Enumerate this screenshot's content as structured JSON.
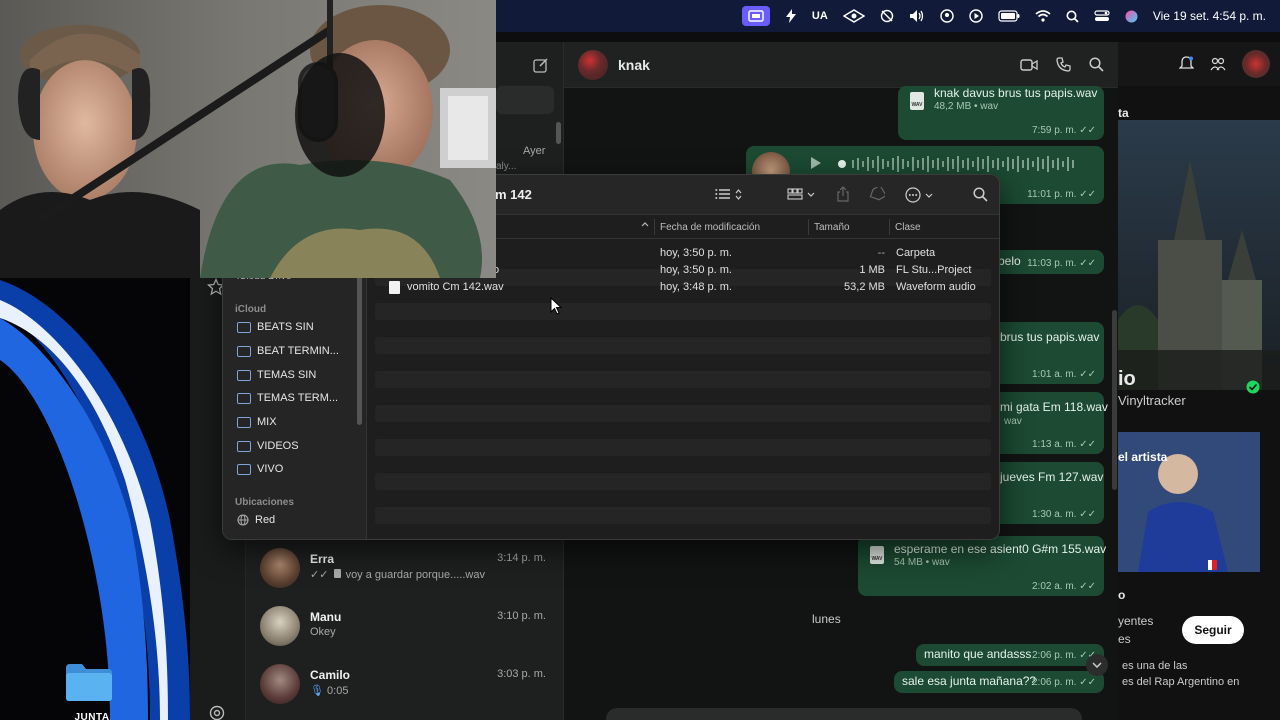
{
  "menubar": {
    "keyboard_layout": "UA",
    "datetime": "Vie 19 set.  4:54 p. m."
  },
  "desktop": {
    "folder_label": "JUNTA"
  },
  "whatsapp": {
    "chat_header": {
      "name": "knak"
    },
    "sidebar_fragment": {
      "time": "Ayer",
      "preview": "aly..."
    },
    "chat_list": [
      {
        "name": "Erra",
        "preview": "voy a guardar porque.....wav",
        "time": "3:14 p. m."
      },
      {
        "name": "Manu",
        "preview": "Okey",
        "time": "3:10 p. m."
      },
      {
        "name": "Camilo",
        "preview": "0:05",
        "time": "3:03 p. m."
      }
    ],
    "messages": [
      {
        "file": "knak davus brus  tus papis.wav",
        "size": "48,2 MB • wav",
        "time": "7:59 p. m."
      },
      {
        "voice_note": true,
        "time": "11:01 p. m."
      },
      {
        "text": "belo",
        "time": "11:03 p. m."
      },
      {
        "text": "brus  tus papis.wav",
        "time": "1:01 a. m."
      },
      {
        "text": "mi gata Em 118.wav",
        "size": "wav",
        "time": "1:13 a. m."
      },
      {
        "text": "jueves Fm 127.wav",
        "time": "1:30 a. m."
      },
      {
        "file": "esperame en ese asient0 G#m 155.wav",
        "size": "54 MB • wav",
        "time": "2:02 a. m."
      }
    ],
    "day_separator": "lunes",
    "recent_messages": [
      {
        "text": "manito que andasss",
        "time": "2:06 p. m."
      },
      {
        "text": "sale esa junta mañana??",
        "time": "2:06 p. m."
      }
    ]
  },
  "right_panel": {
    "fragment_a": "ta",
    "fragment_io": "io",
    "fragment_vinyl": "Vinyltracker",
    "fragment_artist": "el artista",
    "fragment_o": "o",
    "listeners": "yentes",
    "listeners2": "es",
    "follow_label": "Seguir",
    "bio_line1": "es una de las",
    "bio_line2": "es del Rap Argentino en"
  },
  "finder": {
    "title": "m 142",
    "columns": {
      "modified": "Fecha de modificación",
      "size": "Tamaño",
      "kind": "Clase"
    },
    "rows": [
      {
        "name": "",
        "modified": "hoy, 3:50 p. m.",
        "size": "--",
        "kind": "Carpeta"
      },
      {
        "name": "o",
        "modified": "hoy, 3:50 p. m.",
        "size": "1 MB",
        "kind": "FL Stu...Project"
      },
      {
        "name": "vomito Cm 142.wav",
        "modified": "hoy, 3:48 p. m.",
        "size": "53,2 MB",
        "kind": "Waveform audio"
      }
    ],
    "sidebar": {
      "partial_item": "iCloud Drive",
      "icloud_heading": "iCloud",
      "icloud_items": [
        "BEATS SIN",
        "BEAT TERMIN...",
        "TEMAS SIN",
        "TEMAS TERM...",
        "MIX",
        "VIDEOS",
        "VIVO"
      ],
      "locations_heading": "Ubicaciones",
      "locations_items": [
        "Red"
      ]
    }
  },
  "colors": {
    "bubble": "#1c4a32",
    "menubar_accent": "#6a5cff",
    "folder": "#5ab2f0"
  }
}
